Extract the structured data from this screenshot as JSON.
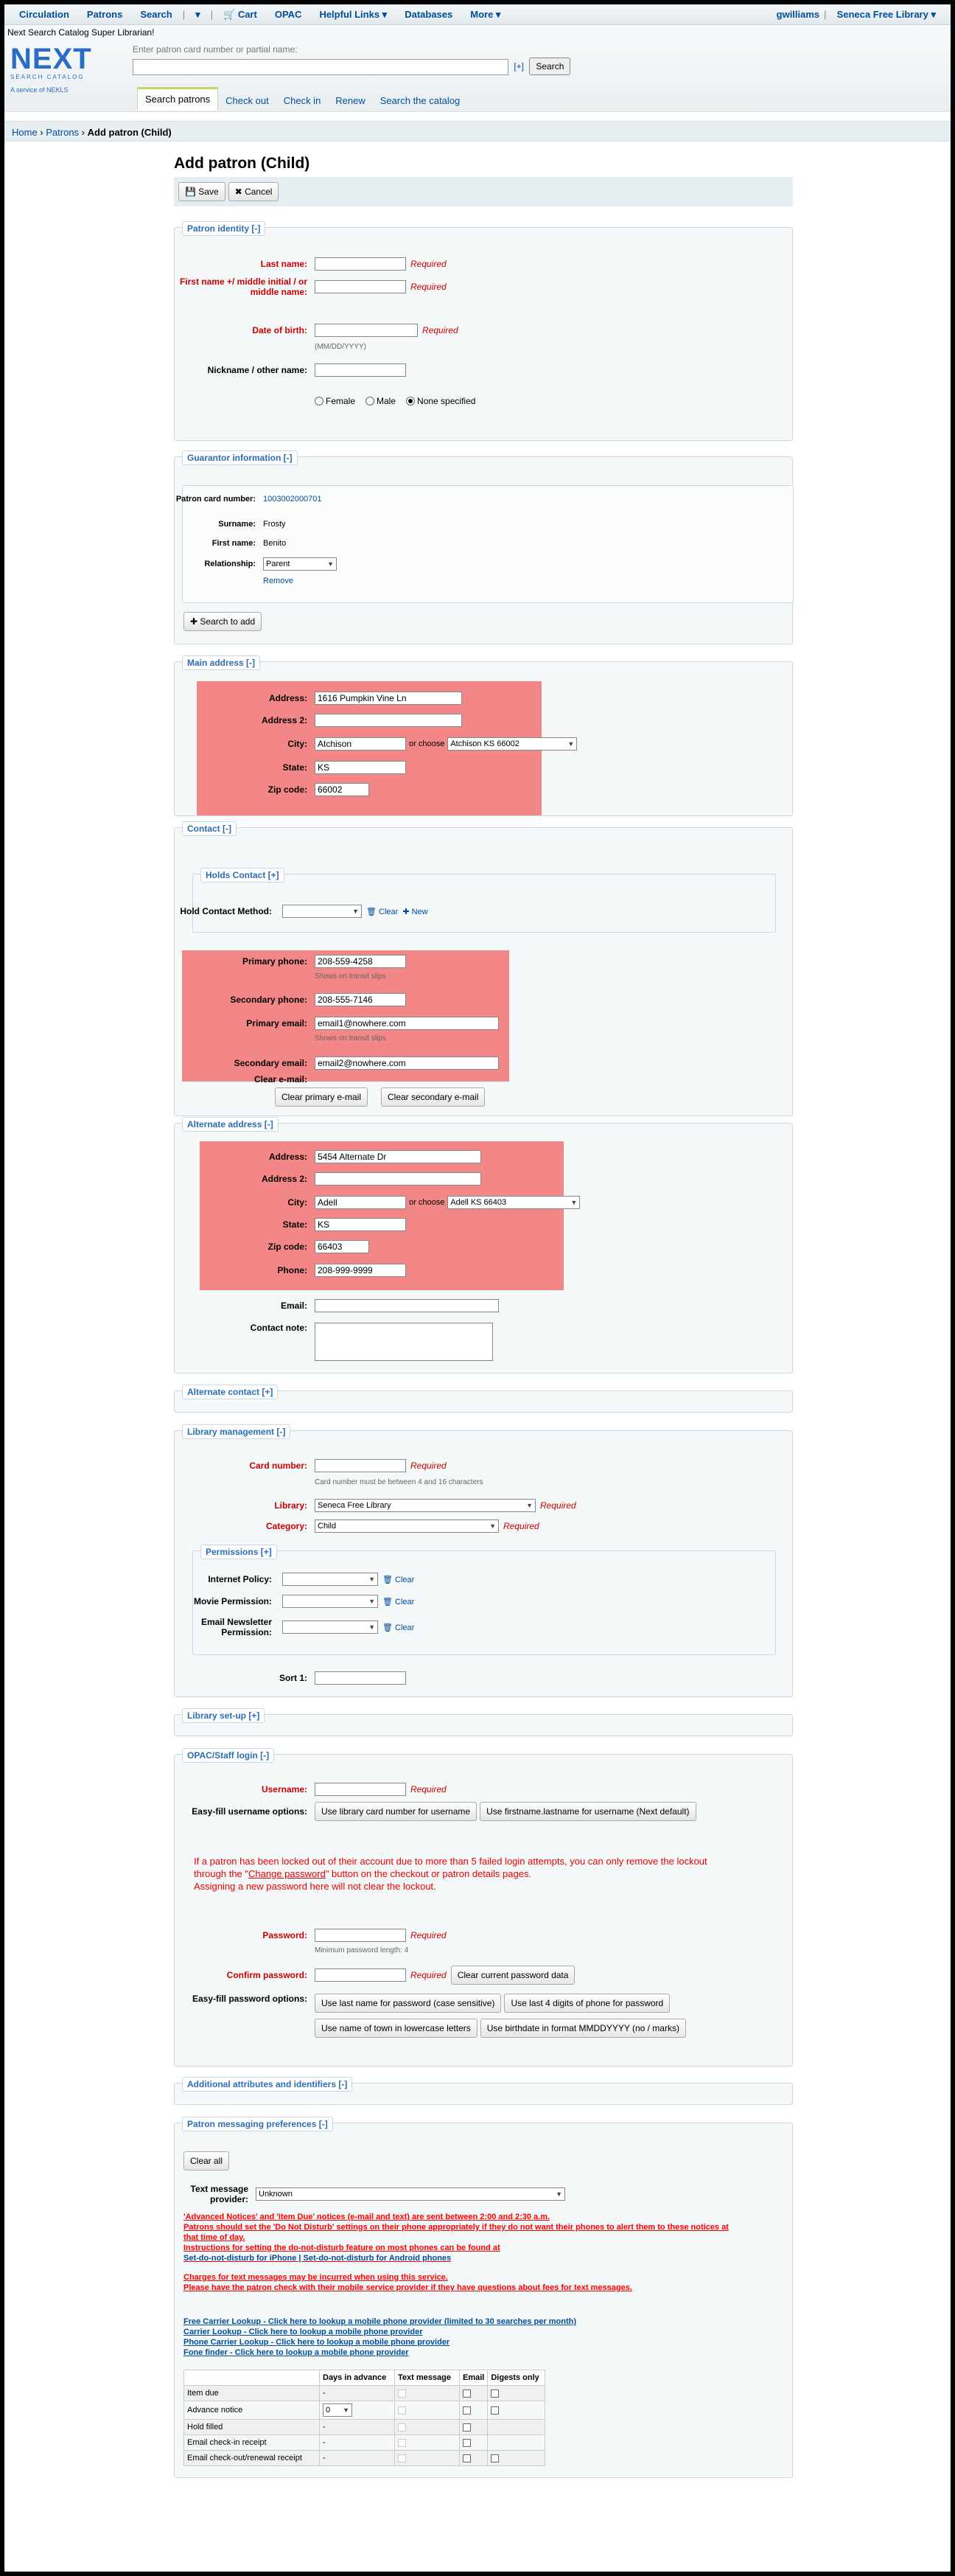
{
  "topnav": {
    "items": [
      "Circulation",
      "Patrons",
      "Search",
      "▾",
      "Cart",
      "OPAC",
      "Helpful Links",
      "Databases",
      "More"
    ],
    "user": "gwilliams",
    "library": "Seneca Free Library"
  },
  "welcome": "Next Search Catalog Super Librarian!",
  "logo": {
    "text": "NEXT",
    "sub": "SEARCH CATALOG",
    "service": "A service of NEKLS"
  },
  "search": {
    "label": "Enter patron card number or partial name:",
    "plus": "[+]",
    "button": "Search"
  },
  "tabs": [
    "Search patrons",
    "Check out",
    "Check in",
    "Renew",
    "Search the catalog"
  ],
  "breadcrumbs": [
    "Home",
    "Patrons",
    "Add patron (Child)"
  ],
  "page_title": "Add patron (Child)",
  "toolbar": {
    "save": "Save",
    "cancel": "Cancel"
  },
  "identity": {
    "legend": "Patron identity [-]",
    "last_name": "Last name:",
    "first_name": "First name +/ middle initial / or middle name:",
    "dob": "Date of birth:",
    "dob_hint": "(MM/DD/YYYY)",
    "nickname": "Nickname / other name:",
    "required": "Required",
    "female": "Female",
    "male": "Male",
    "none": "None specified"
  },
  "guarantor": {
    "legend": "Guarantor information [-]",
    "card_label": "Patron card number:",
    "card": "1003002000701",
    "surname_label": "Surname:",
    "surname": "Frosty",
    "firstname_label": "First name:",
    "firstname": "Benito",
    "relationship_label": "Relationship:",
    "relationship": "Parent",
    "remove": "Remove",
    "search_btn": "Search to add"
  },
  "main_address": {
    "legend": "Main address [-]",
    "address_label": "Address:",
    "address": "1616 Pumpkin Vine Ln",
    "address2_label": "Address 2:",
    "city_label": "City:",
    "city": "Atchison",
    "or_choose": "or choose",
    "city_select": "Atchison KS 66002",
    "state_label": "State:",
    "state": "KS",
    "zip_label": "Zip code:",
    "zip": "66002"
  },
  "contact": {
    "legend": "Contact [-]",
    "holds_legend": "Holds Contact [+]",
    "holds_method": "Hold Contact Method:",
    "clear": "Clear",
    "new": "New",
    "primary_phone_label": "Primary phone:",
    "primary_phone": "208-559-4258",
    "primary_hint": "Shows on transit slips",
    "secondary_phone_label": "Secondary phone:",
    "secondary_phone": "208-555-7146",
    "primary_email_label": "Primary email:",
    "primary_email": "email1@nowhere.com",
    "email_hint": "Shows on transit slips",
    "secondary_email_label": "Secondary email:",
    "secondary_email": "email2@nowhere.com",
    "clear_email_label": "Clear e-mail:",
    "clear_primary": "Clear primary e-mail",
    "clear_secondary": "Clear secondary e-mail"
  },
  "alt_address": {
    "legend": "Alternate address [-]",
    "address_label": "Address:",
    "address": "5454 Alternate Dr",
    "address2_label": "Address 2:",
    "city_label": "City:",
    "city": "Adell",
    "or_choose": "or choose",
    "city_select": "Adell KS 66403",
    "state_label": "State:",
    "state": "KS",
    "zip_label": "Zip code:",
    "zip": "66403",
    "phone_label": "Phone:",
    "phone": "208-999-9999",
    "email_label": "Email:",
    "note_label": "Contact note:"
  },
  "alt_contact": {
    "legend": "Alternate contact [+]"
  },
  "library_mgmt": {
    "legend": "Library management [-]",
    "card_label": "Card number:",
    "required": "Required",
    "card_hint": "Card number must be between 4 and 16 characters",
    "library_label": "Library:",
    "library": "Seneca Free Library",
    "category_label": "Category:",
    "category": "Child",
    "perm_legend": "Permissions [+]",
    "internet": "Internet Policy:",
    "movie": "Movie Permission:",
    "newsletter": "Email Newsletter Permission:",
    "clear": "Clear",
    "sort1": "Sort 1:"
  },
  "library_setup": {
    "legend": "Library set-up [+]"
  },
  "login": {
    "legend": "OPAC/Staff login [-]",
    "username_label": "Username:",
    "required": "Required",
    "easy_fill_label": "Easy-fill username options:",
    "btn_card": "Use library card number for username",
    "btn_name": "Use firstname.lastname for username (Next default)",
    "lockout1": "If a patron has been locked out of their account due to more than 5 failed login attempts, you can only remove the lockout",
    "lockout2a": "through the \"",
    "lockout2link": "Change password",
    "lockout2b": "\" button on the checkout or patron details pages.",
    "lockout3": "Assigning a new password here will not clear the lockout.",
    "password_label": "Password:",
    "pw_hint": "Minimum password length: 4",
    "confirm_label": "Confirm password:",
    "clear_pw": "Clear current password data",
    "easy_pw_label": "Easy-fill password options:",
    "pw_btn1": "Use last name for password (case sensitive)",
    "pw_btn2": "Use last 4 digits of phone for password",
    "pw_btn3": "Use name of town in lowercase letters",
    "pw_btn4": "Use birthdate in format MMDDYYYY (no / marks)"
  },
  "additional": {
    "legend": "Additional attributes and identifiers [-]"
  },
  "messaging": {
    "legend": "Patron messaging preferences [-]",
    "clear_all": "Clear all",
    "provider_label": "Text message provider:",
    "provider": "Unknown",
    "warn1": "'Advanced Notices' and 'Item Due' notices (e-mail and text) are sent between 2:00 and 2:30 a.m.",
    "warn2": "Patrons should set the 'Do Not Disturb' settings on their phone appropriately if they do not want their phones to alert them to these notices at",
    "warn3": "that time of day.",
    "warn4": "Instructions for setting the do-not-disturb feature on most phones can be found at",
    "warn5": "Set-do-not-disturb for iPhone | Set-do-not-disturb for Android phones",
    "warn6": "Charges for text messages may be incurred when using this service.",
    "warn7": "Please have the patron check with their mobile service provider if they have questions about fees for text messages.",
    "link1": "Free Carrier Lookup - Click here to lookup a mobile phone provider (limited to 30 searches per month)",
    "link2": "Carrier Lookup - Click here to lookup a mobile phone provider",
    "link3": "Phone Carrier Lookup - Click here to lookup a mobile phone provider",
    "link4": "Fone finder - Click here to lookup a mobile phone provider",
    "columns": [
      "",
      "Days in advance",
      "Text message",
      "Email",
      "Digests only"
    ],
    "rows": [
      {
        "name": "Item due",
        "days": "-"
      },
      {
        "name": "Advance notice",
        "days": "0"
      },
      {
        "name": "Hold filled",
        "days": "-"
      },
      {
        "name": "Email check-in receipt",
        "days": "-"
      },
      {
        "name": "Email check-out/renewal receipt",
        "days": "-"
      }
    ]
  }
}
